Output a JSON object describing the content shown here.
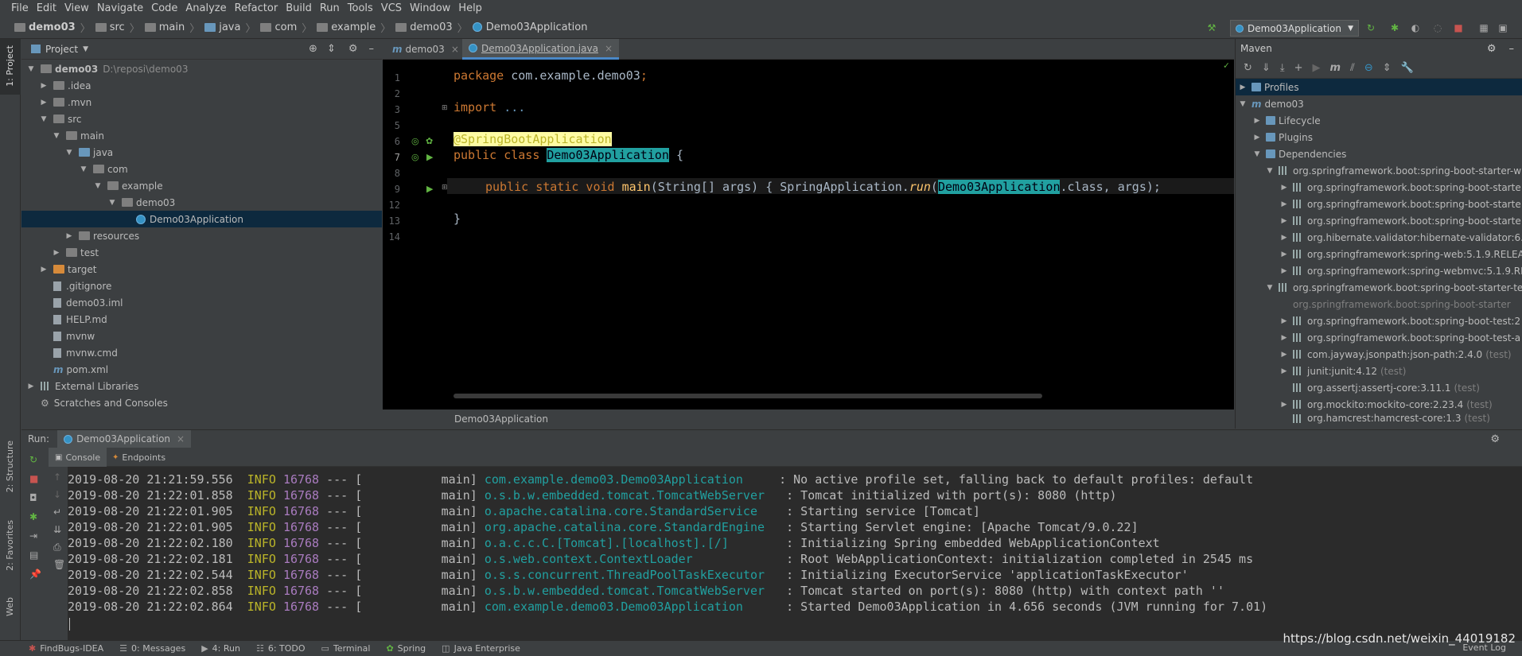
{
  "menu": [
    "File",
    "Edit",
    "View",
    "Navigate",
    "Code",
    "Analyze",
    "Refactor",
    "Build",
    "Run",
    "Tools",
    "VCS",
    "Window",
    "Help"
  ],
  "breadcrumbs": [
    "demo03",
    "src",
    "main",
    "java",
    "com",
    "example",
    "demo03",
    "Demo03Application"
  ],
  "run_config": "Demo03Application",
  "left_strip": {
    "project": "1: Project",
    "structure": "2: Structure",
    "favorites": "2: Favorites",
    "web": "Web"
  },
  "project": {
    "title": "Project",
    "items": [
      {
        "label": "demo03",
        "path": "D:\\reposi\\demo03"
      },
      {
        "label": ".idea"
      },
      {
        "label": ".mvn"
      },
      {
        "label": "src"
      },
      {
        "label": "main"
      },
      {
        "label": "java"
      },
      {
        "label": "com"
      },
      {
        "label": "example"
      },
      {
        "label": "demo03"
      },
      {
        "label": "Demo03Application"
      },
      {
        "label": "resources"
      },
      {
        "label": "test"
      },
      {
        "label": "target"
      },
      {
        "label": ".gitignore"
      },
      {
        "label": "demo03.iml"
      },
      {
        "label": "HELP.md"
      },
      {
        "label": "mvnw"
      },
      {
        "label": "mvnw.cmd"
      },
      {
        "label": "pom.xml"
      },
      {
        "label": "External Libraries"
      },
      {
        "label": "Scratches and Consoles"
      }
    ]
  },
  "editor": {
    "tabs": [
      "demo03",
      "Demo03Application.java"
    ],
    "line_numbers": [
      "1",
      "2",
      "3",
      "5",
      "6",
      "7",
      "8",
      "9",
      "12",
      "13",
      "14"
    ],
    "code": {
      "l1_kw": "package",
      "l1_rest": " com.example.demo03",
      "l3_kw": "import",
      "l3_rest": " ...",
      "l6_ann": "@SpringBootApplication",
      "l7_kw": "public class",
      "l7_cls": "Demo03Application",
      "l7_rest": " {",
      "l9_kw": "public static void",
      "l9_fn": "main",
      "l9_a": "(String[] args) { SpringApplication.",
      "l9_run": "run",
      "l9_cls": "Demo03Application",
      "l9_b": ".class, args);",
      "l13": "}"
    },
    "breadcrumb": "Demo03Application"
  },
  "maven": {
    "title": "Maven",
    "items": [
      {
        "label": "Profiles"
      },
      {
        "label": "demo03"
      },
      {
        "label": "Lifecycle"
      },
      {
        "label": "Plugins"
      },
      {
        "label": "Dependencies"
      },
      {
        "label": "org.springframework.boot:spring-boot-starter-w"
      },
      {
        "label": "org.springframework.boot:spring-boot-starte"
      },
      {
        "label": "org.springframework.boot:spring-boot-starte"
      },
      {
        "label": "org.springframework.boot:spring-boot-starte"
      },
      {
        "label": "org.hibernate.validator:hibernate-validator:6.0"
      },
      {
        "label": "org.springframework:spring-web:5.1.9.RELEAS"
      },
      {
        "label": "org.springframework:spring-webmvc:5.1.9.RE"
      },
      {
        "label": "org.springframework.boot:spring-boot-starter-te"
      },
      {
        "label": "org.springframework.boot:spring-boot-starter"
      },
      {
        "label": "org.springframework.boot:spring-boot-test:2"
      },
      {
        "label": "org.springframework.boot:spring-boot-test-a"
      },
      {
        "label": "com.jayway.jsonpath:json-path:2.4.0",
        "scope": "(test)"
      },
      {
        "label": "junit:junit:4.12",
        "scope": "(test)"
      },
      {
        "label": "org.assertj:assertj-core:3.11.1",
        "scope": "(test)"
      },
      {
        "label": "org.mockito:mockito-core:2.23.4",
        "scope": "(test)"
      },
      {
        "label": "org.hamcrest:hamcrest-core:1.3",
        "scope": "(test)"
      }
    ]
  },
  "run": {
    "label": "Run:",
    "tab": "Demo03Application",
    "console_tab": "Console",
    "endpoints_tab": "Endpoints",
    "logs": [
      {
        "ts": "2019-08-20 21:21:59.556",
        "lvl": "INFO",
        "pid": "16768",
        "thread": "--- [           main]",
        "logger": "com.example.demo03.Demo03Application    ",
        "msg": " : No active profile set, falling back to default profiles: default"
      },
      {
        "ts": "2019-08-20 21:22:01.858",
        "lvl": "INFO",
        "pid": "16768",
        "thread": "--- [           main]",
        "logger": "o.s.b.w.embedded.tomcat.TomcatWebServer  ",
        "msg": " : Tomcat initialized with port(s): 8080 (http)"
      },
      {
        "ts": "2019-08-20 21:22:01.905",
        "lvl": "INFO",
        "pid": "16768",
        "thread": "--- [           main]",
        "logger": "o.apache.catalina.core.StandardService   ",
        "msg": " : Starting service [Tomcat]"
      },
      {
        "ts": "2019-08-20 21:22:01.905",
        "lvl": "INFO",
        "pid": "16768",
        "thread": "--- [           main]",
        "logger": "org.apache.catalina.core.StandardEngine  ",
        "msg": " : Starting Servlet engine: [Apache Tomcat/9.0.22]"
      },
      {
        "ts": "2019-08-20 21:22:02.180",
        "lvl": "INFO",
        "pid": "16768",
        "thread": "--- [           main]",
        "logger": "o.a.c.c.C.[Tomcat].[localhost].[/]       ",
        "msg": " : Initializing Spring embedded WebApplicationContext"
      },
      {
        "ts": "2019-08-20 21:22:02.181",
        "lvl": "INFO",
        "pid": "16768",
        "thread": "--- [           main]",
        "logger": "o.s.web.context.ContextLoader            ",
        "msg": " : Root WebApplicationContext: initialization completed in 2545 ms"
      },
      {
        "ts": "2019-08-20 21:22:02.544",
        "lvl": "INFO",
        "pid": "16768",
        "thread": "--- [           main]",
        "logger": "o.s.s.concurrent.ThreadPoolTaskExecutor  ",
        "msg": " : Initializing ExecutorService 'applicationTaskExecutor'"
      },
      {
        "ts": "2019-08-20 21:22:02.858",
        "lvl": "INFO",
        "pid": "16768",
        "thread": "--- [           main]",
        "logger": "o.s.b.w.embedded.tomcat.TomcatWebServer  ",
        "msg": " : Tomcat started on port(s): 8080 (http) with context path ''"
      },
      {
        "ts": "2019-08-20 21:22:02.864",
        "lvl": "INFO",
        "pid": "16768",
        "thread": "--- [           main]",
        "logger": "com.example.demo03.Demo03Application     ",
        "msg": " : Started Demo03Application in 4.656 seconds (JVM running for 7.01)"
      }
    ]
  },
  "statusbar": [
    "FindBugs-IDEA",
    "0: Messages",
    "4: Run",
    "6: TODO",
    "Terminal",
    "Spring",
    "Java Enterprise"
  ],
  "event_log": "Event Log",
  "watermark": "https://blog.csdn.net/weixin_44019182"
}
